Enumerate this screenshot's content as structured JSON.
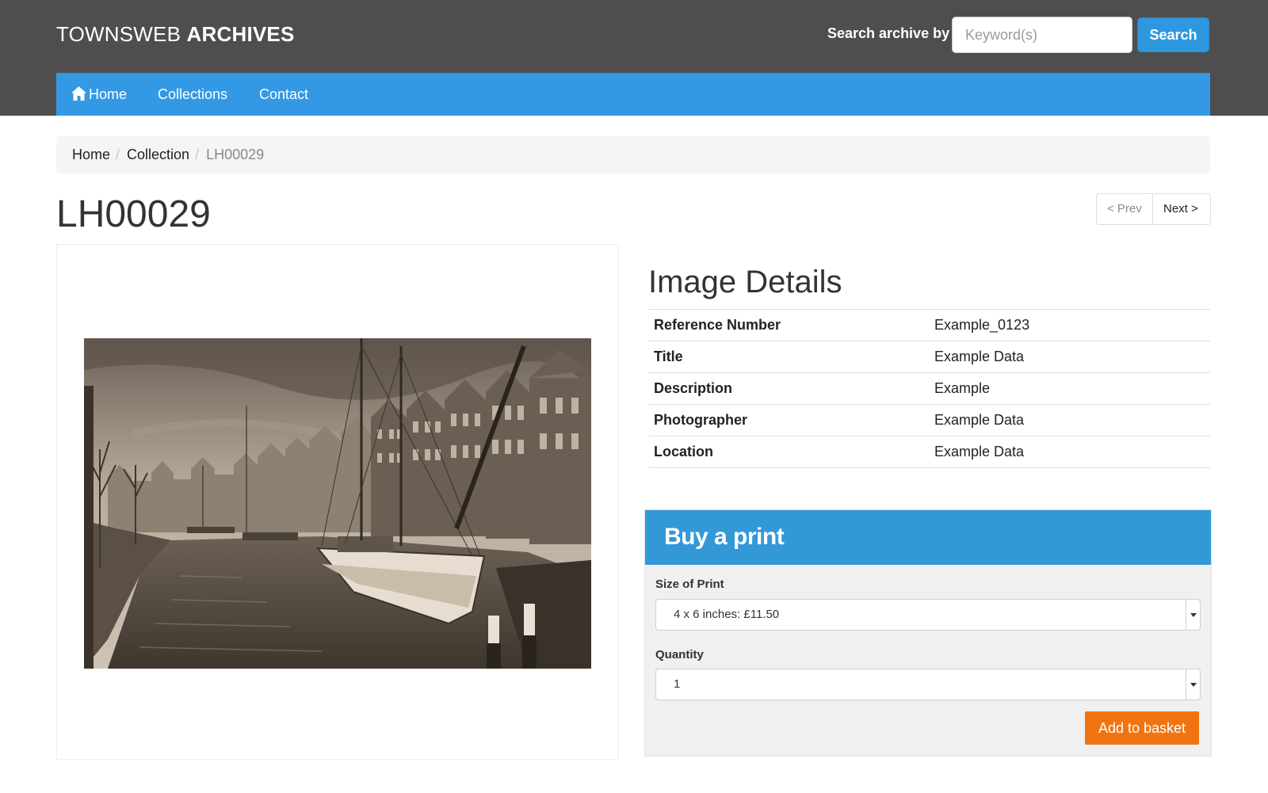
{
  "header": {
    "brand_light": "TOWNSWEB ",
    "brand_bold": "ARCHIVES",
    "search_label": "Search archive by",
    "search_placeholder": "Keyword(s)",
    "search_button": "Search"
  },
  "nav": {
    "items": [
      {
        "label": "Home",
        "icon": "home-icon"
      },
      {
        "label": "Collections"
      },
      {
        "label": "Contact"
      }
    ]
  },
  "breadcrumb": {
    "items": [
      "Home",
      "Collection"
    ],
    "current": "LH00029"
  },
  "page": {
    "title": "LH00029",
    "prev_label": "< Prev",
    "next_label": "Next >"
  },
  "image": {
    "subject": "sepia photograph of a sailing barge moored on a canal lined with tall gabled houses"
  },
  "details": {
    "title": "Image Details",
    "rows": [
      {
        "key": "Reference Number",
        "value": "Example_0123"
      },
      {
        "key": "Title",
        "value": "Example Data"
      },
      {
        "key": "Description",
        "value": "Example"
      },
      {
        "key": "Photographer",
        "value": "Example Data"
      },
      {
        "key": "Location",
        "value": "Example Data"
      }
    ]
  },
  "buy": {
    "title": "Buy a print",
    "size_label": "Size of Print",
    "size_value": "4 x 6 inches: £11.50",
    "quantity_label": "Quantity",
    "quantity_value": "1",
    "add_button": "Add to basket"
  },
  "colors": {
    "topbar": "#4e4e4e",
    "nav": "#3399e5",
    "buy_header": "#3399d6",
    "add_button": "#f07512",
    "search_button": "#2f97e0"
  }
}
